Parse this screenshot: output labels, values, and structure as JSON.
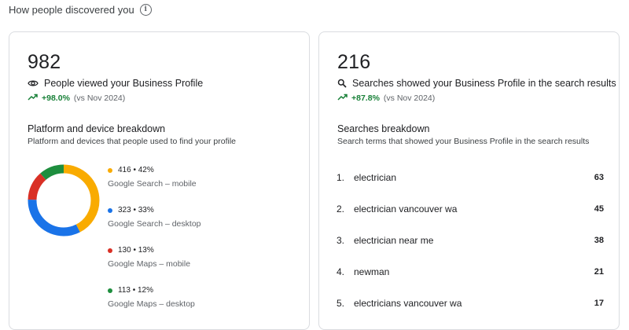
{
  "header": {
    "title": "How people discovered you",
    "info_icon": "info-icon"
  },
  "profile_views": {
    "total": "982",
    "metric_label": "People viewed your Business Profile",
    "metric_icon": "eye-icon",
    "delta_pct": "+98.0%",
    "delta_vs": "(vs Nov 2024)",
    "breakdown_title": "Platform and device breakdown",
    "breakdown_subtitle": "Platform and devices that people used to find your profile"
  },
  "chart_data": {
    "type": "pie",
    "donut": true,
    "slices": [
      {
        "value": 416,
        "pct": 42,
        "stat": "416 • 42%",
        "label": "Google Search – mobile",
        "color": "#f9ab00"
      },
      {
        "value": 323,
        "pct": 33,
        "stat": "323 • 33%",
        "label": "Google Search – desktop",
        "color": "#1a73e8"
      },
      {
        "value": 130,
        "pct": 13,
        "stat": "130 • 13%",
        "label": "Google Maps – mobile",
        "color": "#d93025"
      },
      {
        "value": 113,
        "pct": 12,
        "stat": "113 • 12%",
        "label": "Google Maps – desktop",
        "color": "#1e8e3e"
      }
    ]
  },
  "searches": {
    "total": "216",
    "metric_label": "Searches showed your Business Profile in the search results",
    "metric_icon": "search-icon",
    "delta_pct": "+87.8%",
    "delta_vs": "(vs Nov 2024)",
    "breakdown_title": "Searches breakdown",
    "breakdown_subtitle": "Search terms that showed your Business Profile in the search results",
    "items": [
      {
        "index": "1.",
        "term": "electrician",
        "count": "63"
      },
      {
        "index": "2.",
        "term": "electrician vancouver wa",
        "count": "45"
      },
      {
        "index": "3.",
        "term": "electrician near me",
        "count": "38"
      },
      {
        "index": "4.",
        "term": "newman",
        "count": "21"
      },
      {
        "index": "5.",
        "term": "electricians vancouver wa",
        "count": "17"
      }
    ]
  },
  "colors": {
    "trend_green": "#188038",
    "card_border": "#dadce0"
  }
}
